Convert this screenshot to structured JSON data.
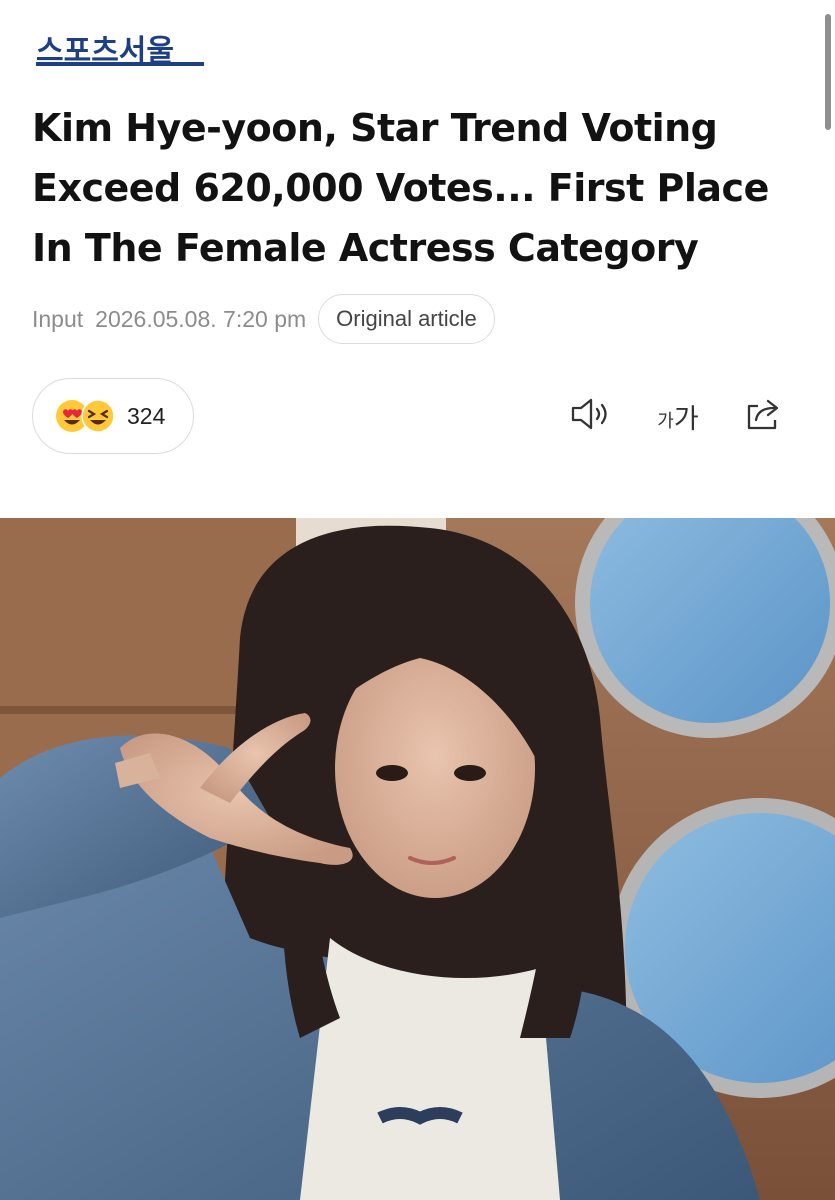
{
  "brand": {
    "logo_text": "스포츠서울",
    "color": "#1d3f86"
  },
  "article": {
    "headline_lines": [
      "Kim Hye-yoon, Star Trend Voting",
      "Exceed 620,000 Votes... First Place",
      "In The Female Actress Category"
    ],
    "input_label": "Input",
    "date": "2026.05.08. 7:20 pm",
    "original_button": "Original article"
  },
  "reactions": {
    "icons": [
      "heart-eyes-emoji-icon",
      "laughing-emoji-icon"
    ],
    "count": "324"
  },
  "toolbar": {
    "icons": [
      "speaker-icon",
      "font-size-icon",
      "share-icon"
    ],
    "font_small": "가",
    "font_large": "가"
  },
  "photo": {
    "description_icon": "article-photo"
  }
}
